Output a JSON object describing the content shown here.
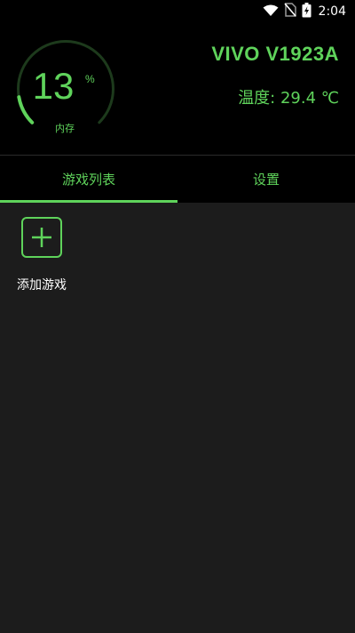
{
  "status_bar": {
    "time": "2:04",
    "icons": [
      "wifi-icon",
      "no-sim-icon",
      "battery-charging-icon"
    ]
  },
  "header": {
    "memory_percent": "13",
    "memory_unit": "%",
    "memory_label": "内存",
    "memory_fill": 0.13,
    "device_name": "VIVO V1923A",
    "temperature": "温度: 29.4 ℃"
  },
  "tabs": [
    {
      "label": "游戏列表",
      "active": true
    },
    {
      "label": "设置",
      "active": false
    }
  ],
  "content": {
    "add_game_label": "添加游戏",
    "add_icon": "plus-icon"
  },
  "colors": {
    "accent": "#5fd35b",
    "header_bg": "#000000",
    "content_bg": "#1c1c1c",
    "ring_track": "#1d3a1c"
  }
}
